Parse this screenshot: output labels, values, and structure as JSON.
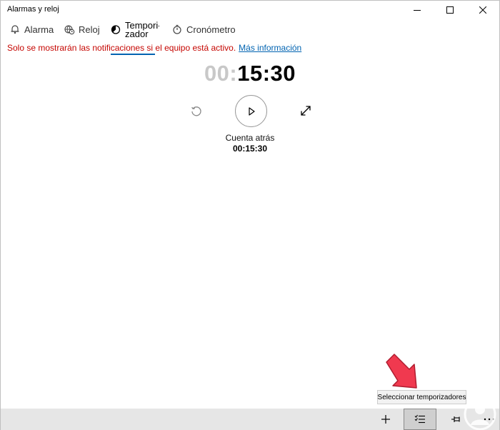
{
  "window": {
    "title": "Alarmas y reloj"
  },
  "tabs": [
    {
      "id": "alarma",
      "label": "Alarma",
      "icon": "bell-icon"
    },
    {
      "id": "reloj",
      "label": "Reloj",
      "icon": "globe-clock-icon"
    },
    {
      "id": "temporizador",
      "label": "Tempori-zador",
      "icon": "timer-icon",
      "selected": true
    },
    {
      "id": "cronometro",
      "label": "Cronómetro",
      "icon": "stopwatch-icon"
    }
  ],
  "notice": {
    "text": "Solo se mostrarán las notificaciones si el equipo está activo.",
    "link": "Más información"
  },
  "timer": {
    "hours": "00",
    "separator": ":",
    "minutes_seconds": "15:30",
    "name": "Cuenta atrás",
    "remaining": "00:15:30"
  },
  "tooltip": {
    "text": "Seleccionar temporizadores"
  },
  "colors": {
    "accent": "#0063b1",
    "warning": "#c50500",
    "annotation": "#f0394f",
    "commandbar": "#e6e6e6"
  }
}
